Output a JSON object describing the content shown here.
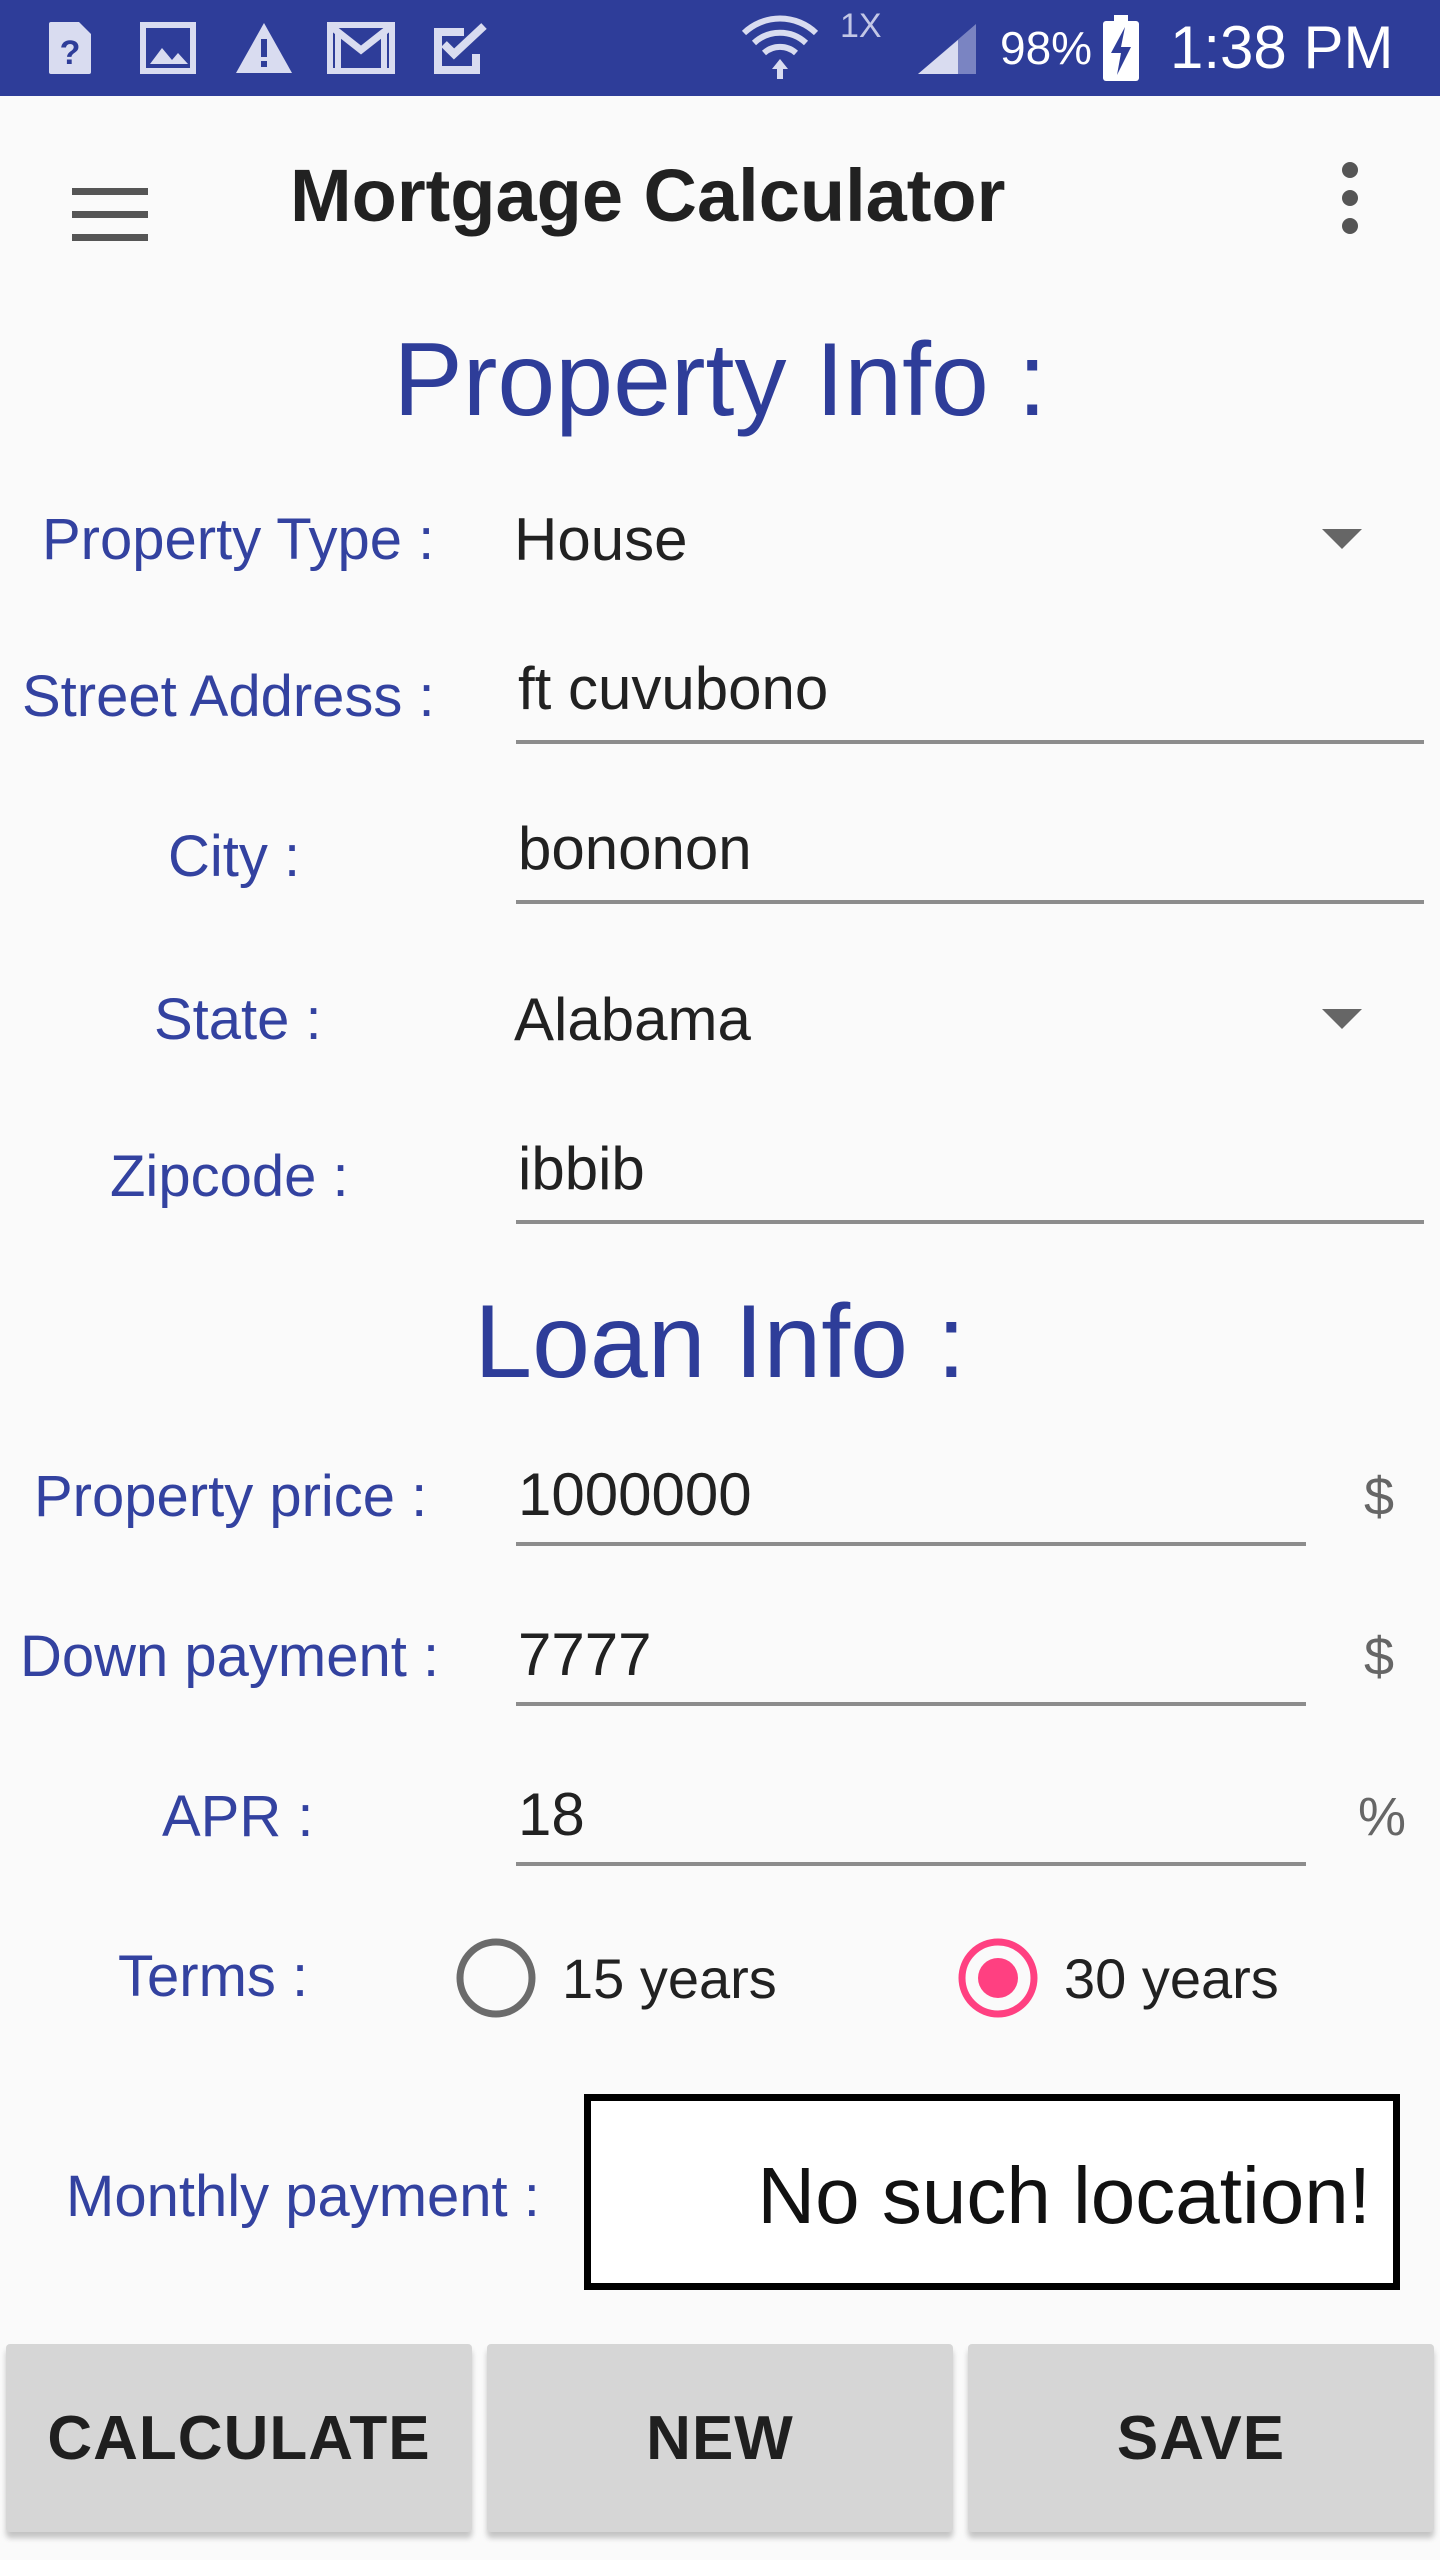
{
  "status_bar": {
    "network_label": "1X",
    "battery": "98%",
    "time": "1:38 PM",
    "bg_color": "#2e3d99"
  },
  "app_bar": {
    "title": "Mortgage Calculator",
    "menu_icon": "hamburger-menu-icon",
    "overflow_icon": "more-vert-icon"
  },
  "property_info": {
    "heading": "Property Info :",
    "property_type": {
      "label": "Property Type :",
      "value": "House"
    },
    "street_address": {
      "label": "Street Address :",
      "value": "ft cuvubono"
    },
    "city": {
      "label": "City :",
      "value": "bononon"
    },
    "state": {
      "label": "State :",
      "value": "Alabama"
    },
    "zipcode": {
      "label": "Zipcode :",
      "value": "ibbib"
    }
  },
  "loan_info": {
    "heading": "Loan Info :",
    "property_price": {
      "label": "Property price :",
      "value": "1000000",
      "unit": "$"
    },
    "down_payment": {
      "label": "Down payment :",
      "value": "7777",
      "unit": "$"
    },
    "apr": {
      "label": "APR :",
      "value": "18",
      "unit": "%"
    },
    "terms": {
      "label": "Terms :",
      "options": [
        "15 years",
        "30 years"
      ],
      "selected": "30 years"
    },
    "monthly_payment": {
      "label": "Monthly payment :",
      "value": "No such location!"
    }
  },
  "buttons": {
    "calculate": "CALCULATE",
    "new": "NEW",
    "save": "SAVE"
  },
  "colors": {
    "primary": "#2e3d99",
    "label": "#3342a0",
    "accent": "#ff4081",
    "button_bg": "#d6d6d6"
  }
}
